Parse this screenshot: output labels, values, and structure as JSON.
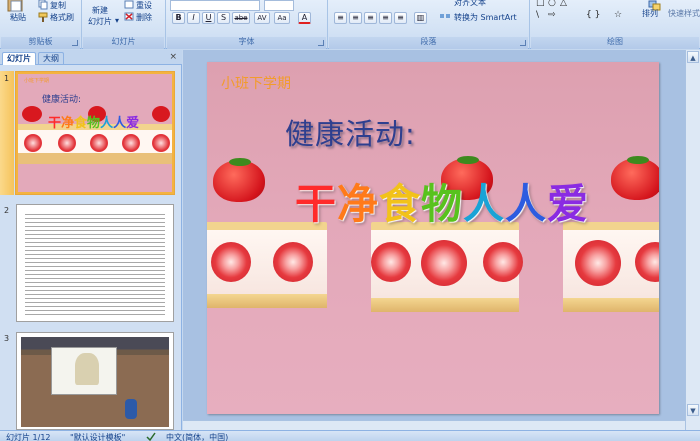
{
  "ribbon": {
    "clipboard": {
      "paste": "粘贴",
      "copy": "复制",
      "format_painter": "格式刷",
      "label": "剪贴板"
    },
    "slides": {
      "new_slide": "新建",
      "new_slide_line2": "幻灯片",
      "reset": "重设",
      "delete": "删除",
      "label": "幻灯片"
    },
    "font": {
      "label": "字体",
      "bold": "B",
      "italic": "I",
      "underline": "U",
      "shadow": "S",
      "strike": "abe",
      "spacing": "AV",
      "case": "Aa",
      "color": "A"
    },
    "paragraph": {
      "label": "段落",
      "align_text": "对齐文本",
      "convert_smartart": "转换为 SmartArt"
    },
    "drawing": {
      "label": "绘图",
      "arrange": "排列",
      "quick_styles": "快速样式"
    }
  },
  "left_panel": {
    "tabs": {
      "slides": "幻灯片",
      "outline": "大纲",
      "close": "×"
    },
    "thumbs": [
      {
        "num": "1",
        "sub": "小班下学期",
        "h2": "健康活动:",
        "title": "干净食物人人爱"
      },
      {
        "num": "2"
      },
      {
        "num": "3"
      }
    ]
  },
  "slide": {
    "subtitle": "小班下学期",
    "heading": "健康活动:",
    "title_chars": [
      "干",
      "净",
      "食",
      "物",
      "人",
      "人",
      "爱"
    ],
    "title_colors": [
      "#ff2a2a",
      "#ff7a1a",
      "#f2c21a",
      "#58c21e",
      "#19a3d6",
      "#2d5ce0",
      "#8a2be2"
    ]
  },
  "scroll": {
    "up": "▲",
    "down": "▼",
    "left": "◄",
    "right": "►"
  },
  "status": {
    "slide_count": "幻灯片 1/12",
    "theme": "\"默认设计模板\"",
    "language": "中文(简体，中国)"
  }
}
